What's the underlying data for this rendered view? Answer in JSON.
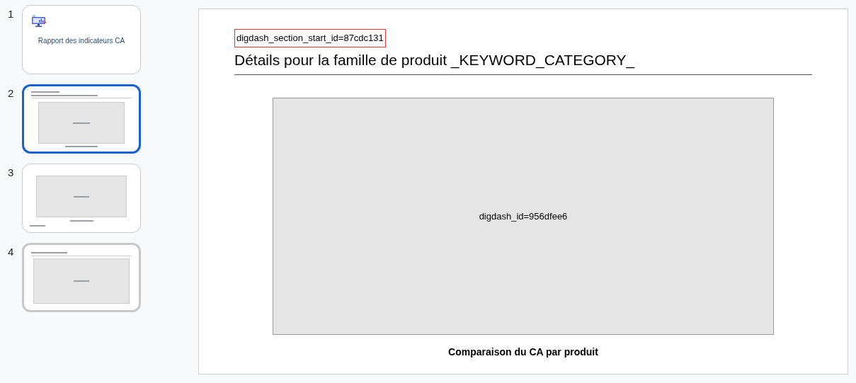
{
  "slides": [
    {
      "number": "1",
      "kind": "title",
      "selected": false,
      "hovered": false,
      "title": "Rapport des indicateurs CA"
    },
    {
      "number": "2",
      "kind": "section",
      "selected": true,
      "hovered": false
    },
    {
      "number": "3",
      "kind": "chart",
      "selected": false,
      "hovered": false
    },
    {
      "number": "4",
      "kind": "titled-chart",
      "selected": false,
      "hovered": true
    }
  ],
  "slide": {
    "section_marker": "digdash_section_start_id=87cdc131",
    "title": "Détails pour la famille de produit _KEYWORD_CATEGORY_",
    "placeholder": "digdash_id=956dfee6",
    "caption": "Comparaison du CA par produit"
  }
}
